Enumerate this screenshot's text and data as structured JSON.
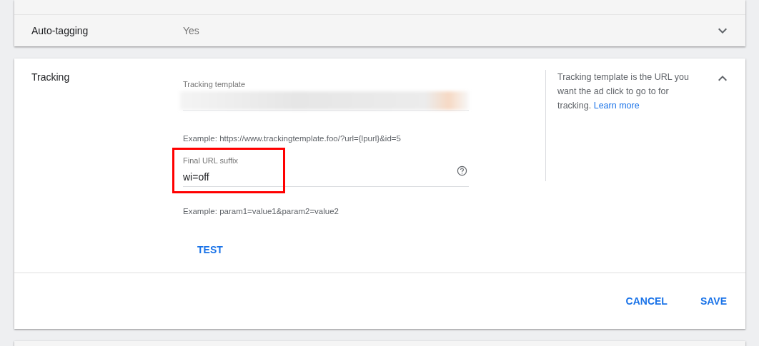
{
  "summary_rows": [
    {
      "label": "Auto-tagging",
      "value": "Yes",
      "expanded": false
    }
  ],
  "tracking": {
    "label": "Tracking",
    "expanded": true,
    "fields": [
      {
        "label": "Tracking template",
        "kind": "redacted",
        "example": "Example: https://www.trackingtemplate.foo/?url={lpurl}&id=5",
        "highlighted": false,
        "help_icon": false
      },
      {
        "label": "Final URL suffix",
        "kind": "text",
        "value": "wi=off",
        "example": "Example: param1=value1&param2=value2",
        "highlighted": true,
        "help_icon": true
      }
    ],
    "test_button": "TEST",
    "help_text": "Tracking template is the URL you want the ad click to go to for tracking.",
    "help_link": "Learn more",
    "buttons": [
      "CANCEL",
      "SAVE"
    ]
  }
}
